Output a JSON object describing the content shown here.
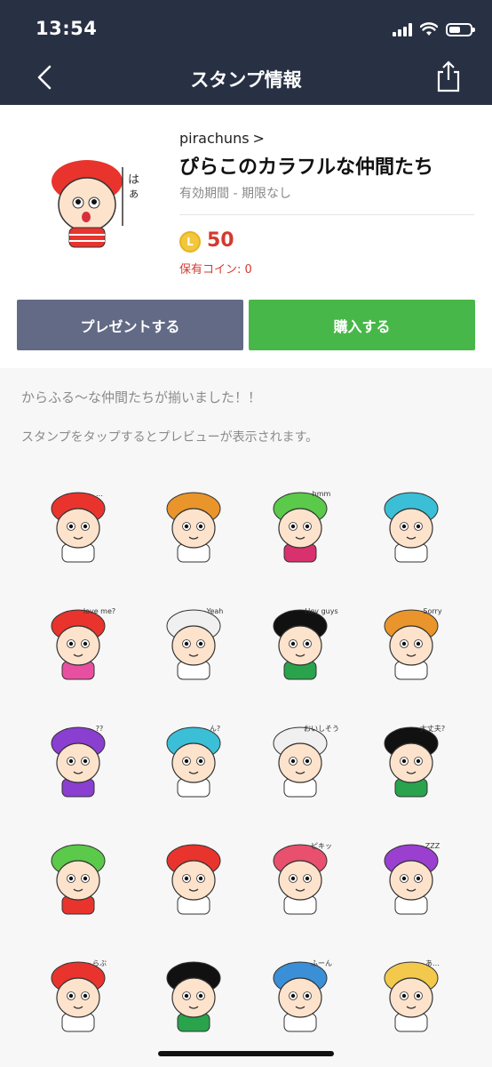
{
  "status_bar": {
    "time": "13:54"
  },
  "header": {
    "title": "スタンプ情報"
  },
  "product": {
    "author": "pirachuns",
    "title": "ぴらこのカラフルな仲間たち",
    "validity": "有効期間 - 期限なし",
    "coin_symbol": "L",
    "price": "50",
    "owned_coins": "保有コイン: 0"
  },
  "actions": {
    "gift_label": "プレゼントする",
    "buy_label": "購入する"
  },
  "description": "からふる〜な仲間たちが揃いました！！",
  "preview_hint": "スタンプをタップするとプレビューが表示されます。",
  "stickers": [
    {
      "hair": "#e8342d",
      "caption": "…",
      "body": "#ffffff"
    },
    {
      "hair": "#e9952b",
      "caption": "",
      "body": "#ffffff"
    },
    {
      "hair": "#5bc94a",
      "caption": "hmm",
      "body": "#d9306e"
    },
    {
      "hair": "#3bbfd6",
      "caption": "",
      "body": "#ffffff"
    },
    {
      "hair": "#e8342d",
      "caption": "love me?",
      "body": "#e94fa0"
    },
    {
      "hair": "#f0f0f0",
      "caption": "Yeah",
      "body": "#ffffff"
    },
    {
      "hair": "#111111",
      "caption": "Hey guys",
      "body": "#29a34c"
    },
    {
      "hair": "#e9952b",
      "caption": "Sorry",
      "body": "#ffffff"
    },
    {
      "hair": "#8a3fd0",
      "caption": "??",
      "body": "#8a3fd0"
    },
    {
      "hair": "#3bbfd6",
      "caption": "ん?",
      "body": "#ffffff"
    },
    {
      "hair": "#f0f0f0",
      "caption": "おいしそう",
      "body": "#ffffff"
    },
    {
      "hair": "#111111",
      "caption": "大丈夫?",
      "body": "#29a34c"
    },
    {
      "hair": "#5bc94a",
      "caption": "",
      "body": "#e8342d"
    },
    {
      "hair": "#e8342d",
      "caption": "",
      "body": "#ffffff"
    },
    {
      "hair": "#e8506e",
      "caption": "ピキッ",
      "body": "#ffffff"
    },
    {
      "hair": "#9a3fd0",
      "caption": "ZZZ",
      "body": "#ffffff"
    },
    {
      "hair": "#e8342d",
      "caption": "らぶ",
      "body": "#ffffff"
    },
    {
      "hair": "#111111",
      "caption": "",
      "body": "#29a34c"
    },
    {
      "hair": "#3b8fd6",
      "caption": "ふーん",
      "body": "#ffffff"
    },
    {
      "hair": "#f2c94c",
      "caption": "あ…",
      "body": "#ffffff"
    }
  ]
}
